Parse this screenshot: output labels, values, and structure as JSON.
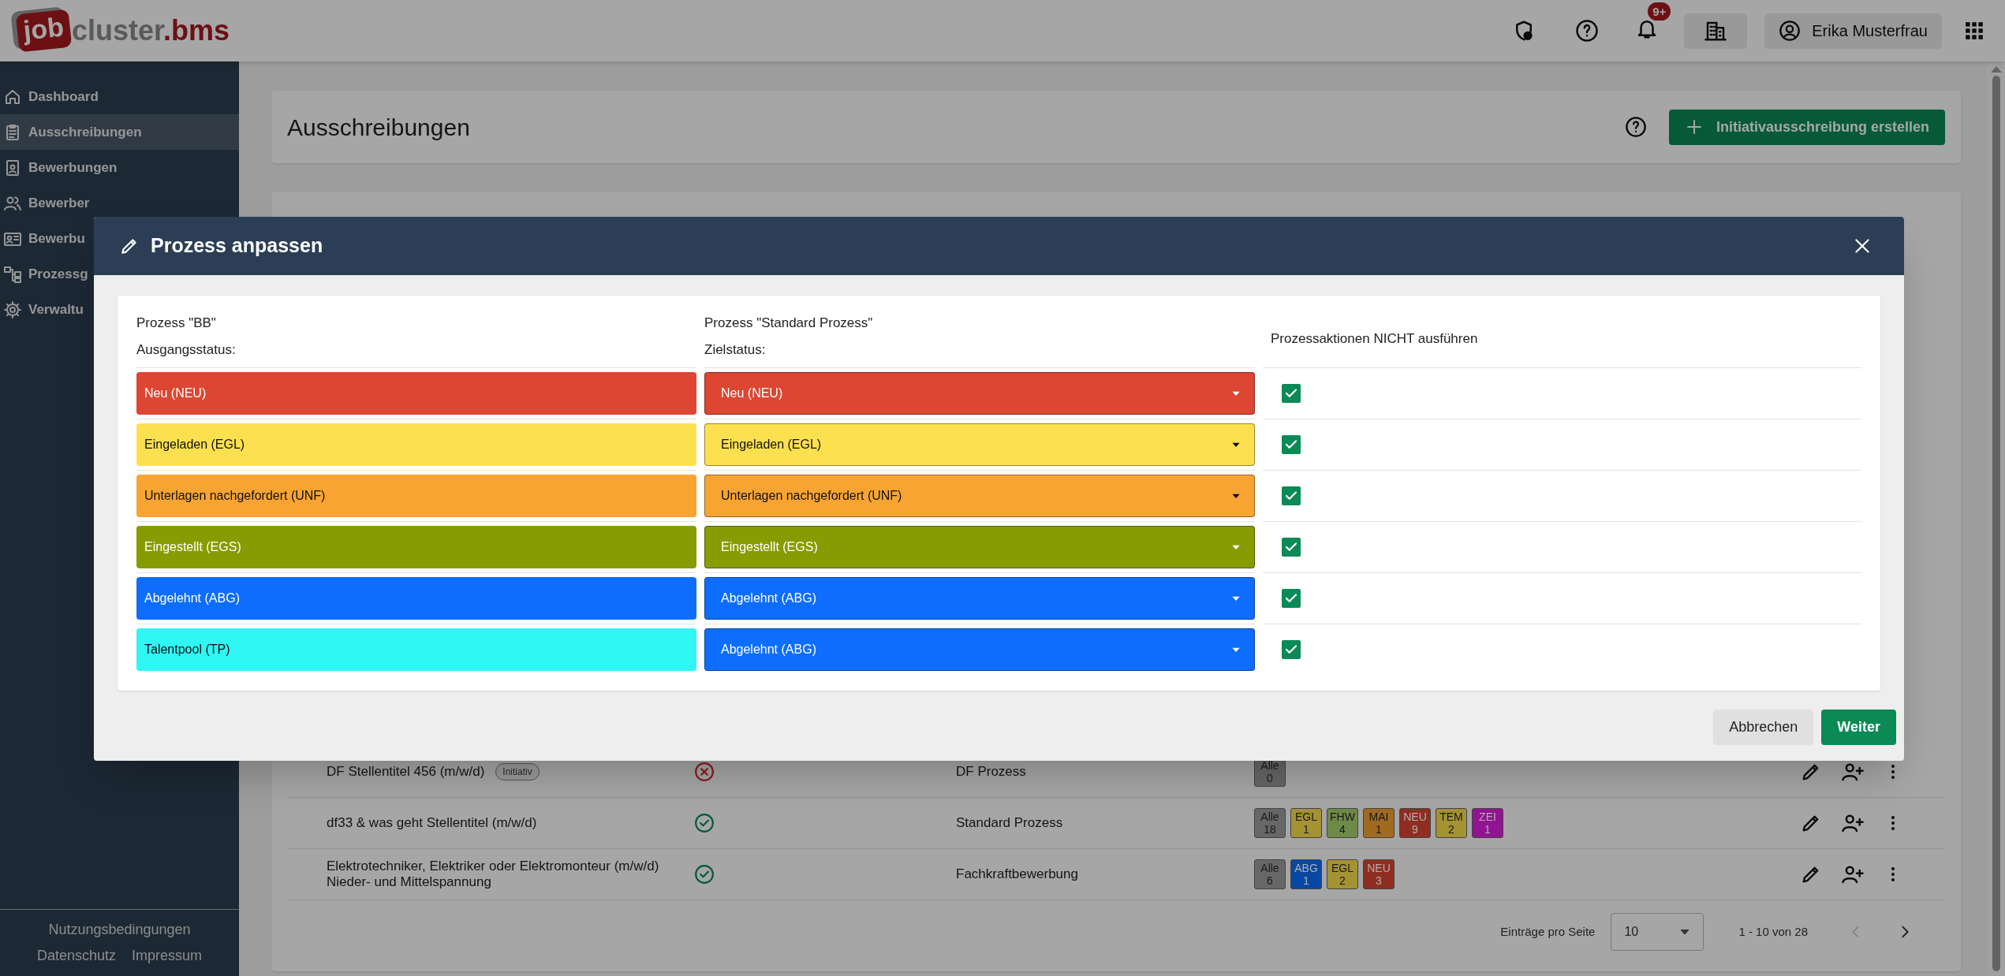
{
  "logo": {
    "mark": "job",
    "name": "cluster",
    "suffix": ".bms"
  },
  "header": {
    "notifications": "9+",
    "user": "Erika Musterfrau"
  },
  "sidebar": {
    "items": [
      {
        "label": "Dashboard",
        "selected": false
      },
      {
        "label": "Ausschreibungen",
        "selected": true
      },
      {
        "label": "Bewerbungen",
        "selected": false
      },
      {
        "label": "Bewerber",
        "selected": false
      },
      {
        "label": "Bewerbu",
        "selected": false
      },
      {
        "label": "Prozessg",
        "selected": false
      },
      {
        "label": "Verwaltu",
        "selected": false
      }
    ],
    "footer_links": [
      "Nutzungsbedingungen",
      "Datenschutz",
      "Impressum"
    ]
  },
  "page": {
    "title": "Ausschreibungen",
    "create_button": "Initiativausschreibung erstellen"
  },
  "table": {
    "rows": [
      {
        "title": "DF Stellentitel 456 (m/w/d)",
        "tag": "Initiativ",
        "valid": false,
        "process": "DF Prozess",
        "badges": [
          {
            "label": "Alle",
            "count": "0",
            "color": "#676767"
          }
        ]
      },
      {
        "title": "df33 & was geht Stellentitel (m/w/d)",
        "valid": true,
        "process": "Standard Prozess",
        "badges": [
          {
            "label": "Alle",
            "count": "18",
            "color": "#676767"
          },
          {
            "label": "EGL",
            "count": "1",
            "color": "#a49233"
          },
          {
            "label": "FHW",
            "count": "4",
            "color": "#6e8a48"
          },
          {
            "label": "MAI",
            "count": "1",
            "color": "#a16a21"
          },
          {
            "label": "NEU",
            "count": "9",
            "color": "#8f2e20"
          },
          {
            "label": "TEM",
            "count": "2",
            "color": "#a49233"
          },
          {
            "label": "ZEI",
            "count": "1",
            "color": "#931492"
          }
        ]
      },
      {
        "title": "Elektrotechniker, Elektriker oder Elektromonteur (m/w/d) Nieder- und Mittelspannung",
        "valid": true,
        "process": "Fachkraftbewerbung",
        "badges": [
          {
            "label": "Alle",
            "count": "6",
            "color": "#676767"
          },
          {
            "label": "ABG",
            "count": "1",
            "color": "#0848a4"
          },
          {
            "label": "EGL",
            "count": "2",
            "color": "#a49233"
          },
          {
            "label": "NEU",
            "count": "3",
            "color": "#8f2e20"
          }
        ]
      }
    ],
    "pagination": {
      "label": "Einträge pro Seite",
      "page_size": "10",
      "range": "1 - 10 von 28"
    }
  },
  "modal": {
    "title": "Prozess anpassen",
    "source_header": "Prozess \"BB\"",
    "source_sub": "Ausgangsstatus:",
    "target_header": "Prozess \"Standard Prozess\"",
    "target_sub": "Zielstatus:",
    "skip_header": "Prozessaktionen NICHT ausführen",
    "rows": [
      {
        "source": {
          "label": "Neu (NEU)",
          "color": "#dc4632"
        },
        "target": {
          "label": "Neu (NEU)",
          "color": "#dc4632"
        },
        "skip_actions": true
      },
      {
        "source": {
          "label": "Eingeladen (EGL)",
          "color": "#fde04f"
        },
        "target": {
          "label": "Eingeladen (EGL)",
          "color": "#fde04f"
        },
        "skip_actions": true
      },
      {
        "source": {
          "label": "Unterlagen nachgefordert (UNF)",
          "color": "#f8a433"
        },
        "target": {
          "label": "Unterlagen nachgefordert (UNF)",
          "color": "#f8a433"
        },
        "skip_actions": true
      },
      {
        "source": {
          "label": "Eingestellt (EGS)",
          "color": "#879c00"
        },
        "target": {
          "label": "Eingestellt (EGS)",
          "color": "#879c00"
        },
        "skip_actions": true
      },
      {
        "source": {
          "label": "Abgelehnt (ABG)",
          "color": "#0d6efd"
        },
        "target": {
          "label": "Abgelehnt (ABG)",
          "color": "#0d6efd"
        },
        "skip_actions": true
      },
      {
        "source": {
          "label": "Talentpool (TP)",
          "color": "#2ef7f4"
        },
        "target": {
          "label": "Abgelehnt (ABG)",
          "color": "#0d6efd"
        },
        "skip_actions": true
      }
    ],
    "buttons": {
      "cancel": "Abbrechen",
      "next": "Weiter"
    }
  }
}
